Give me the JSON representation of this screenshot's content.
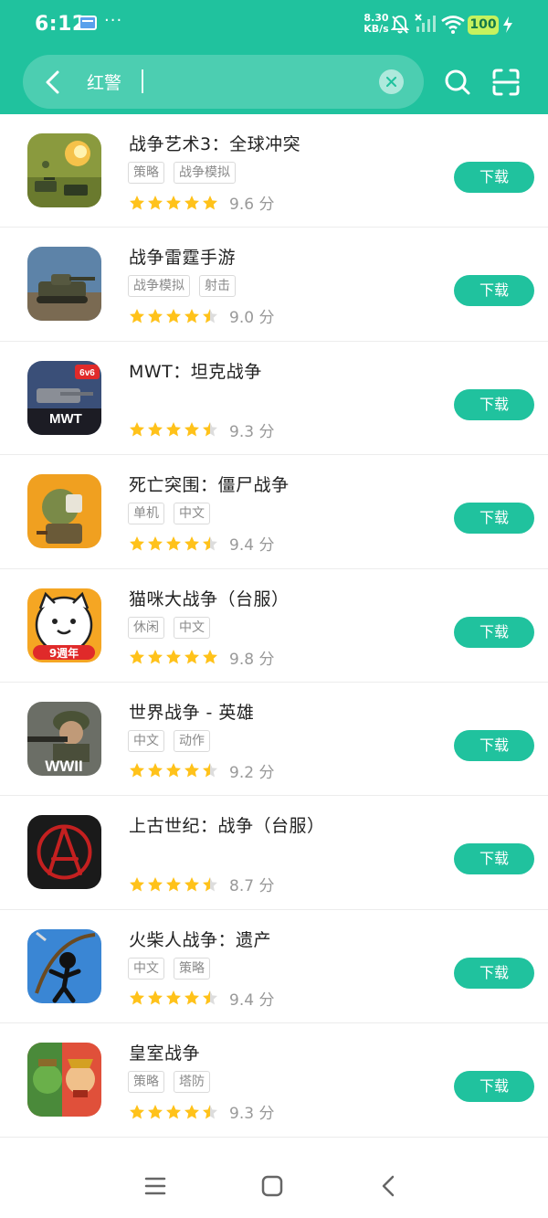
{
  "status_bar": {
    "time": "6:12",
    "more": "···",
    "net_speed_value": "8.30",
    "net_speed_unit": "KB/s",
    "battery": "100"
  },
  "search": {
    "query": "红警"
  },
  "apps": [
    {
      "name": "战争艺术3：全球冲突",
      "tags": [
        "策略",
        "战争模拟"
      ],
      "rating": 5.0,
      "score": "9.6 分",
      "button": "下载",
      "icon": "war-art-3-icon"
    },
    {
      "name": "战争雷霆手游",
      "tags": [
        "战争模拟",
        "射击"
      ],
      "rating": 4.5,
      "score": "9.0 分",
      "button": "下载",
      "icon": "war-thunder-icon"
    },
    {
      "name": "MWT：坦克战争",
      "tags": [],
      "rating": 4.5,
      "score": "9.3 分",
      "button": "下载",
      "icon": "mwt-icon",
      "icon_text": "6v6",
      "icon_logo": "MWT"
    },
    {
      "name": "死亡突围：僵尸战争",
      "tags": [
        "单机",
        "中文"
      ],
      "rating": 4.5,
      "score": "9.4 分",
      "button": "下载",
      "icon": "dead-ahead-icon"
    },
    {
      "name": "猫咪大战争（台服）",
      "tags": [
        "休闲",
        "中文"
      ],
      "rating": 5.0,
      "score": "9.8 分",
      "button": "下载",
      "icon": "battle-cats-icon",
      "icon_text": "9週年"
    },
    {
      "name": "世界战争 - 英雄",
      "tags": [
        "中文",
        "动作"
      ],
      "rating": 4.5,
      "score": "9.2 分",
      "button": "下载",
      "icon": "world-war-heroes-icon",
      "icon_text": "WWII"
    },
    {
      "name": "上古世纪：战争（台服）",
      "tags": [],
      "rating": 4.5,
      "score": "8.7 分",
      "button": "下载",
      "icon": "archeage-war-icon"
    },
    {
      "name": "火柴人战争：遗产",
      "tags": [
        "中文",
        "策略"
      ],
      "rating": 4.5,
      "score": "9.4 分",
      "button": "下载",
      "icon": "stick-war-icon"
    },
    {
      "name": "皇室战争",
      "tags": [
        "策略",
        "塔防"
      ],
      "rating": 4.5,
      "score": "9.3 分",
      "button": "下载",
      "icon": "clash-royale-icon"
    }
  ],
  "colors": {
    "accent": "#20c29e",
    "star": "#ffc21a",
    "star_empty": "#dddddd"
  }
}
